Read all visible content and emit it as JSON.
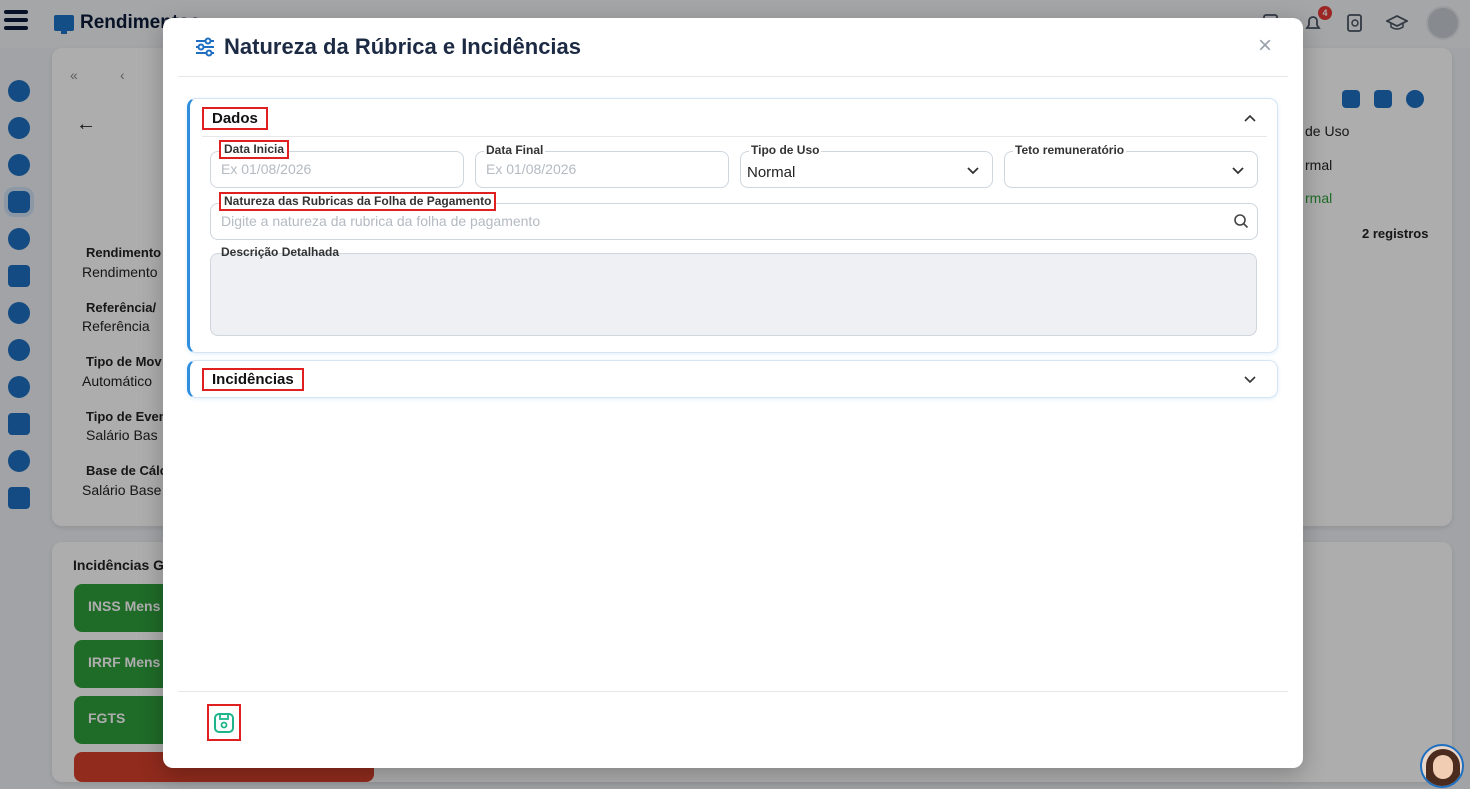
{
  "app": {
    "title": "Rendimentos",
    "notification_count": "4"
  },
  "background": {
    "fields": [
      {
        "label": "Rendimento",
        "value": "Rendimento"
      },
      {
        "label": "Referência/",
        "value": "Referência"
      },
      {
        "label": "Tipo de Mov",
        "value": "Automático"
      },
      {
        "label": "Tipo de Even",
        "value": "Salário Bas"
      },
      {
        "label": "Base de Cálc",
        "value": "Salário Base"
      }
    ],
    "incidencias_title": "Incidências G",
    "incidence_buttons": [
      "INSS Mens",
      "IRRF Mens",
      "FGTS"
    ],
    "table": {
      "column_header": "de Uso",
      "rows": [
        "rmal",
        "rmal"
      ],
      "count": "2 registros"
    }
  },
  "modal": {
    "title": "Natureza da Rúbrica e Incidências",
    "close_label": "×",
    "sections": {
      "dados": {
        "title": "Dados",
        "data_inicial": {
          "label": "Data Inicia",
          "placeholder": "Ex 01/08/2026"
        },
        "data_final": {
          "label": "Data Final",
          "placeholder": "Ex 01/08/2026"
        },
        "tipo_uso": {
          "label": "Tipo de Uso",
          "value": "Normal"
        },
        "teto": {
          "label": "Teto remuneratório",
          "value": ""
        },
        "natureza": {
          "label": "Natureza das Rubricas da Folha de Pagamento",
          "placeholder": "Digite a natureza da rubrica da folha de pagamento"
        },
        "descricao": {
          "label": "Descrição Detalhada",
          "value": ""
        }
      },
      "incidencias": {
        "title": "Incidências"
      }
    }
  },
  "colors": {
    "primary": "#1e6fc2",
    "accent_border": "#2f8fdc",
    "highlight": "#e02020",
    "save_icon": "#1db48a"
  }
}
